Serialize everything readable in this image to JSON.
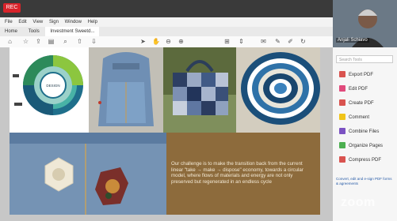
{
  "recording": {
    "label": "REC"
  },
  "menu": [
    "File",
    "Edit",
    "View",
    "Sign",
    "Window",
    "Help"
  ],
  "tabs": [
    {
      "label": "Home",
      "active": false
    },
    {
      "label": "Tools",
      "active": false
    },
    {
      "label": "Investment Sweetd...",
      "active": true
    }
  ],
  "document": {
    "wheel_center_label": "DESIGN",
    "quote": "Our challenge is to make the transition back from the current linear \"take → make → dispose\" economy, towards a circular model, where flows of materials and energy are not only preserved but regenerated in an endless cycle"
  },
  "panel": {
    "search_placeholder": "Search Tools",
    "items": [
      {
        "label": "Export PDF",
        "color": "#d9534f"
      },
      {
        "label": "Edit PDF",
        "color": "#e04a7c"
      },
      {
        "label": "Create PDF",
        "color": "#d9534f"
      },
      {
        "label": "Comment",
        "color": "#f0c419"
      },
      {
        "label": "Combine Files",
        "color": "#7b52c2"
      },
      {
        "label": "Organize Pages",
        "color": "#4caf50"
      },
      {
        "label": "Compress PDF",
        "color": "#d9534f"
      }
    ],
    "footer": "Convert, edit and e-sign PDF forms & agreements"
  },
  "video": {
    "participant_name": "Anjali Schiavo"
  },
  "watermark": "zoom"
}
